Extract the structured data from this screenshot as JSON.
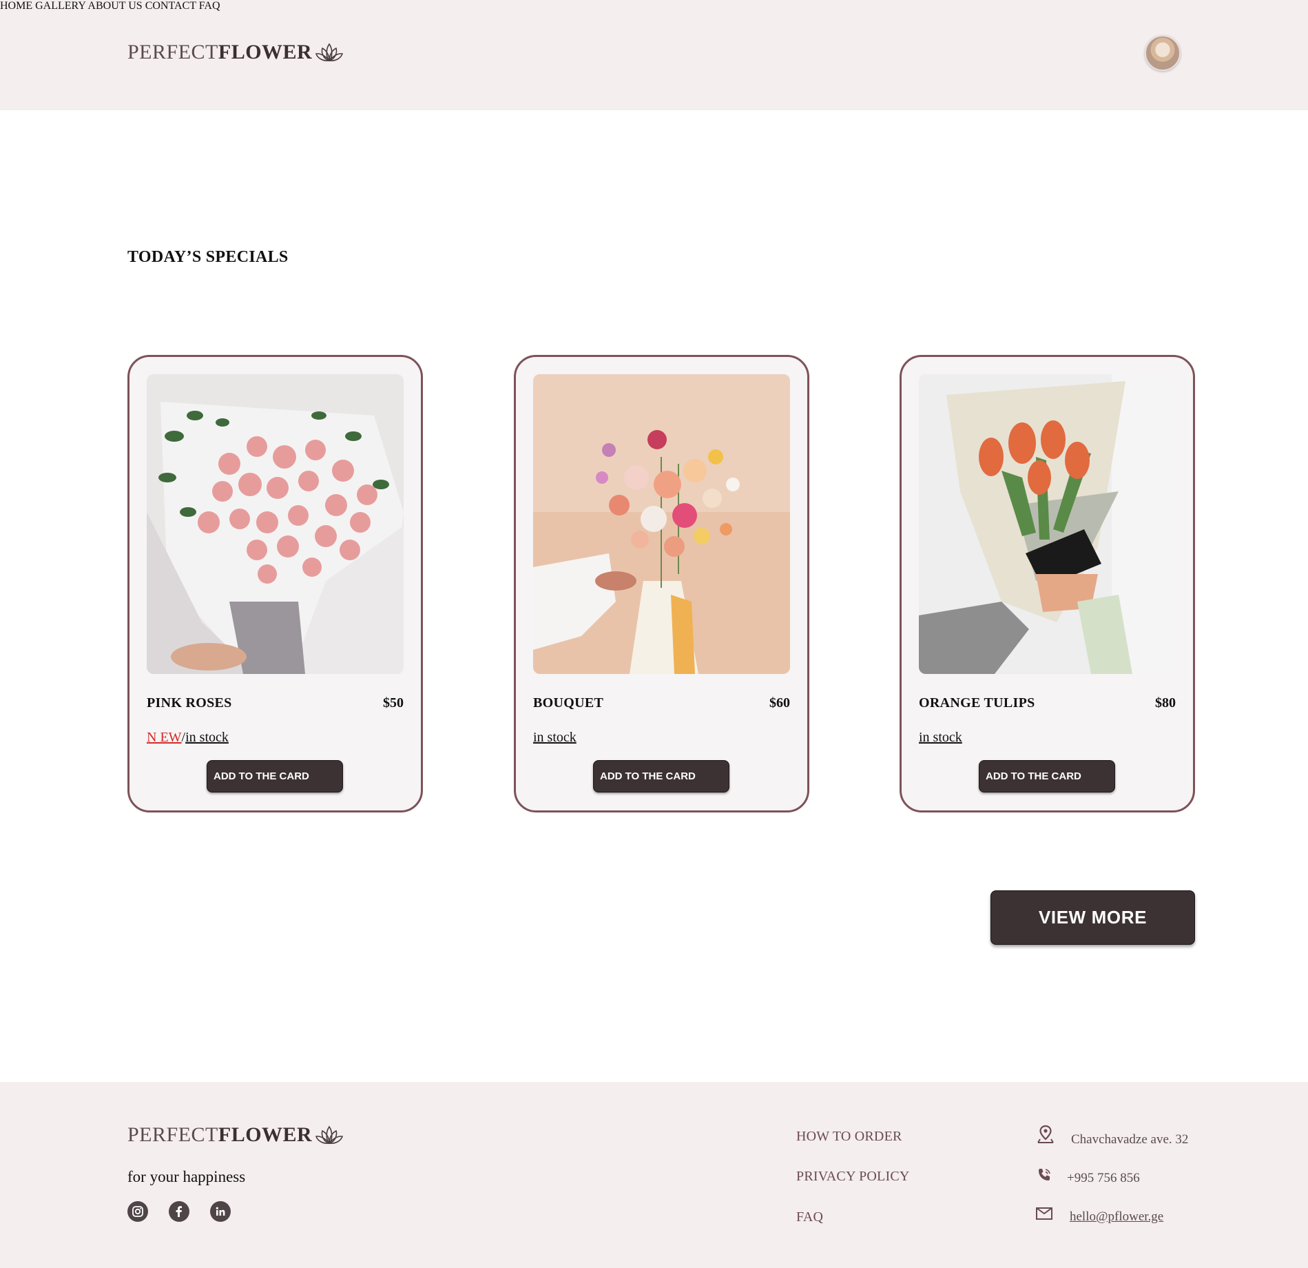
{
  "brand": {
    "light": "PERFECT",
    "bold": "FLOWER",
    "icon": "lotus-icon"
  },
  "nav": {
    "items": [
      "HOME",
      "GALLERY",
      "ABOUT US",
      "CONTACT",
      "FAQ"
    ]
  },
  "section": {
    "title": "TODAY’S SPECIALS"
  },
  "products": [
    {
      "name": "PINK ROSES",
      "price": "$50",
      "badge": "N EW",
      "separator": "/",
      "stock": "in stock",
      "button": "ADD TO THE CARD"
    },
    {
      "name": "BOUQUET",
      "price": "$60",
      "stock": "in stock",
      "button": "ADD TO THE CARD"
    },
    {
      "name": "ORANGE TULIPS",
      "price": "$80",
      "stock": "in stock",
      "button": "ADD TO THE CARD"
    }
  ],
  "view_more": "VIEW MORE",
  "footer": {
    "tagline": "for your happiness",
    "social": [
      "instagram-icon",
      "facebook-icon",
      "linkedin-icon"
    ],
    "links": [
      "HOW TO ORDER",
      "PRIVACY POLICY",
      "FAQ"
    ],
    "contacts": {
      "address": "Chavchavadze ave. 32",
      "phone": "+995 756 856",
      "email": "hello@pflower.ge"
    }
  },
  "colors": {
    "header_bg": "#f4eeee",
    "accent": "#7d5259",
    "button": "#3d3233",
    "nav_text": "#6b4a52",
    "new_badge": "#d42a2a"
  }
}
